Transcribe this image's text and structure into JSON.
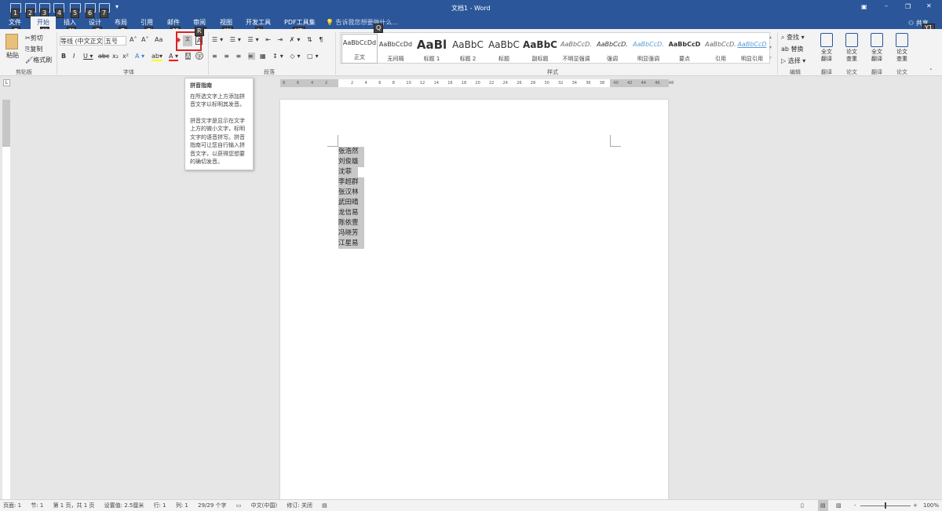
{
  "window": {
    "title": "文档1 - Word",
    "share": "共享"
  },
  "quick_access_keytips": [
    "1",
    "2",
    "3",
    "4",
    "5",
    "6",
    "7"
  ],
  "tabs": [
    {
      "label": "文件",
      "key": "F"
    },
    {
      "label": "开始",
      "key": "H",
      "active": true
    },
    {
      "label": "插入",
      "key": "N"
    },
    {
      "label": "设计",
      "key": "G"
    },
    {
      "label": "布局",
      "key": "P"
    },
    {
      "label": "引用",
      "key": "S"
    },
    {
      "label": "邮件",
      "key": "M"
    },
    {
      "label": "审阅",
      "key": "R"
    },
    {
      "label": "视图",
      "key": "W"
    },
    {
      "label": "开发工具",
      "key": "L"
    },
    {
      "label": "PDF工具集",
      "key": "Y2"
    }
  ],
  "tell_me": {
    "placeholder": "告诉我您想要做什么...",
    "key": "Q"
  },
  "share_key": "Y1",
  "clipboard": {
    "paste": "粘贴",
    "cut": "剪切",
    "copy": "复制",
    "format_painter": "格式刷",
    "group": "剪贴板"
  },
  "font": {
    "name": "等线 (中文正文)",
    "size": "五号",
    "group": "字体",
    "change_case": "Aa"
  },
  "paragraph": {
    "group": "段落"
  },
  "styles": {
    "group": "样式",
    "items": [
      {
        "preview": "AaBbCcDd",
        "label": "正文"
      },
      {
        "preview": "AaBbCcDd",
        "label": "无间隔"
      },
      {
        "preview": "AaBl",
        "label": "标题 1"
      },
      {
        "preview": "AaBbC",
        "label": "标题 2"
      },
      {
        "preview": "AaBbC",
        "label": "标题"
      },
      {
        "preview": "AaBbC",
        "label": "副标题"
      },
      {
        "preview": "AaBbCcD.",
        "label": "不明显强调"
      },
      {
        "preview": "AaBbCcD.",
        "label": "强调"
      },
      {
        "preview": "AaBbCcD.",
        "label": "明显强调"
      },
      {
        "preview": "AaBbCcD",
        "label": "要点"
      },
      {
        "preview": "AaBbCcD.",
        "label": "引用"
      },
      {
        "preview": "AaBbCcD",
        "label": "明显引用"
      }
    ]
  },
  "editing": {
    "find": "查找",
    "replace": "替换",
    "select": "选择",
    "group": "编辑"
  },
  "addins": [
    {
      "label": "全文\n翻译",
      "group": "翻译"
    },
    {
      "label": "论文\n查重",
      "group": "论文"
    },
    {
      "label": "全文\n翻译",
      "group": "翻译"
    },
    {
      "label": "论文\n查重",
      "group": "论文"
    }
  ],
  "tooltip": {
    "title": "拼音指南",
    "p1": "在所选文字上方添加拼音文字以标明其发音。",
    "p2": "拼音文字是显示在文字上方的微小文字，标明文字的语音拼写。拼音指南可让您自行输入拼音文字，以获得您想要的确切发音。"
  },
  "ruler": {
    "left": [
      "8",
      "6",
      "4",
      "2"
    ],
    "right": [
      "2",
      "4",
      "6",
      "8",
      "10",
      "12",
      "14",
      "16",
      "18",
      "20",
      "22",
      "24",
      "26",
      "28",
      "30",
      "32",
      "34",
      "36",
      "38",
      "40",
      "42",
      "44",
      "46",
      "48"
    ]
  },
  "document": {
    "lines": [
      "张浩然",
      "刘俊雄",
      "沈菲",
      "李超群",
      "张汉林",
      "武田晴",
      "龙信易",
      "陈依壹",
      "冯晓芳",
      "江星易"
    ]
  },
  "status": {
    "page": "页面: 1",
    "section": "节: 1",
    "pages": "第 1 页，共 1 页",
    "position": "设置值: 2.5厘米",
    "row": "行: 1",
    "col": "列: 1",
    "words": "29/29 个字",
    "lang": "中文(中国)",
    "track": "修订: 关闭",
    "zoom": "100%",
    "zoom_level": 100
  },
  "colors": {
    "brand": "#2b579a",
    "highlight": "#ff0000"
  }
}
